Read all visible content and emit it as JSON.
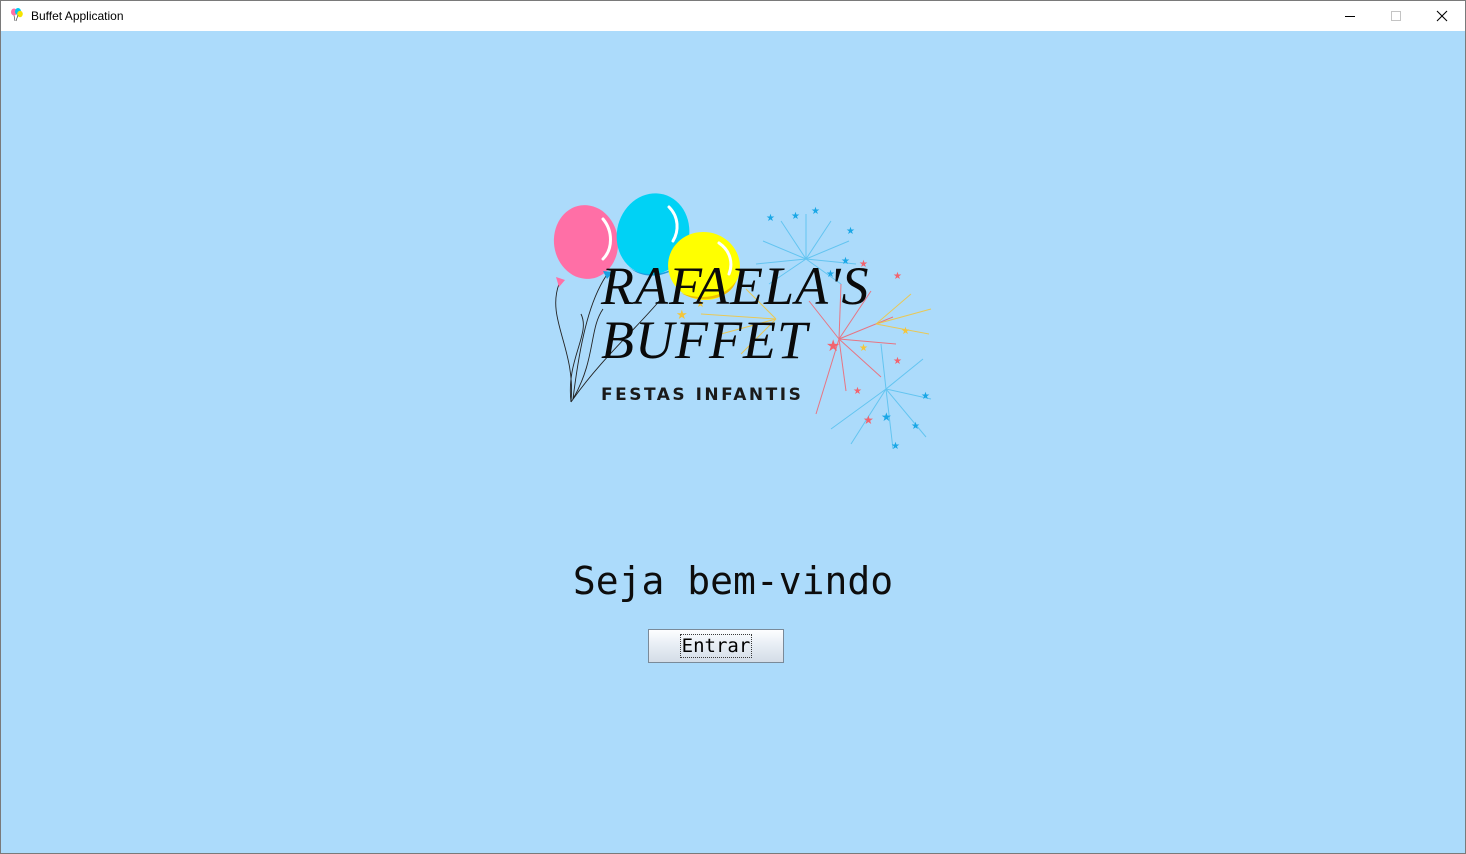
{
  "window": {
    "title": "Buffet Application"
  },
  "logo": {
    "title_line1": "RAFAELA'S",
    "title_line2": "BUFFET",
    "subtitle": "FESTAS INFANTIS"
  },
  "main": {
    "welcome_text": "Seja bem-vindo",
    "enter_button_label": "Entrar"
  },
  "colors": {
    "background": "#acdbfb",
    "balloon_pink": "#ff6fa6",
    "balloon_blue": "#00d2f5",
    "balloon_yellow": "#ffff00"
  },
  "icons": [
    "app-balloons-icon",
    "minimize-icon",
    "maximize-icon",
    "close-icon"
  ]
}
